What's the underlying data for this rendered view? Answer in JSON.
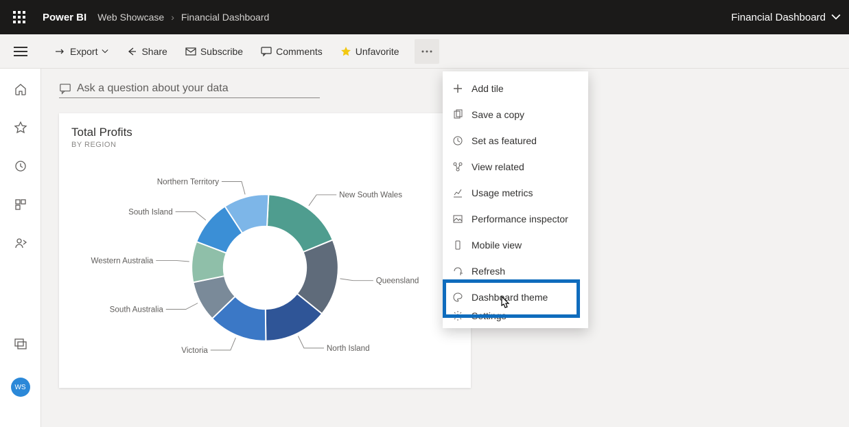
{
  "header": {
    "brand": "Power BI",
    "crumb1": "Web Showcase",
    "crumb2": "Financial Dashboard",
    "currentDashboard": "Financial Dashboard"
  },
  "toolbar": {
    "export": "Export",
    "share": "Share",
    "subscribe": "Subscribe",
    "comments": "Comments",
    "unfavorite": "Unfavorite"
  },
  "ask": {
    "placeholder": "Ask a question about your data"
  },
  "tile": {
    "title": "Total Profits",
    "subtitle": "BY REGION"
  },
  "menu": {
    "addTile": "Add tile",
    "saveCopy": "Save a copy",
    "setFeatured": "Set as featured",
    "viewRelated": "View related",
    "usageMetrics": "Usage metrics",
    "perfInspector": "Performance inspector",
    "mobileView": "Mobile view",
    "refresh": "Refresh",
    "dashboardTheme": "Dashboard theme",
    "settings": "Settings"
  },
  "rail": {
    "avatar": "WS"
  },
  "chart_data": {
    "type": "pie",
    "title": "Total Profits",
    "subtitle": "BY REGION",
    "series": [
      {
        "name": "New South Wales",
        "value": 18,
        "color": "#4f9d8f"
      },
      {
        "name": "Queensland",
        "value": 17,
        "color": "#5f6b7a"
      },
      {
        "name": "North Island",
        "value": 14,
        "color": "#2f5597"
      },
      {
        "name": "Victoria",
        "value": 13,
        "color": "#3b78c6"
      },
      {
        "name": "South Australia",
        "value": 9,
        "color": "#7a8a99"
      },
      {
        "name": "Western Australia",
        "value": 9,
        "color": "#8fbfa9"
      },
      {
        "name": "South Island",
        "value": 10,
        "color": "#3b8fd6"
      },
      {
        "name": "Northern Territory",
        "value": 10,
        "color": "#7db6e8"
      }
    ],
    "note": "values are approximate percentage shares estimated from slice angles"
  }
}
